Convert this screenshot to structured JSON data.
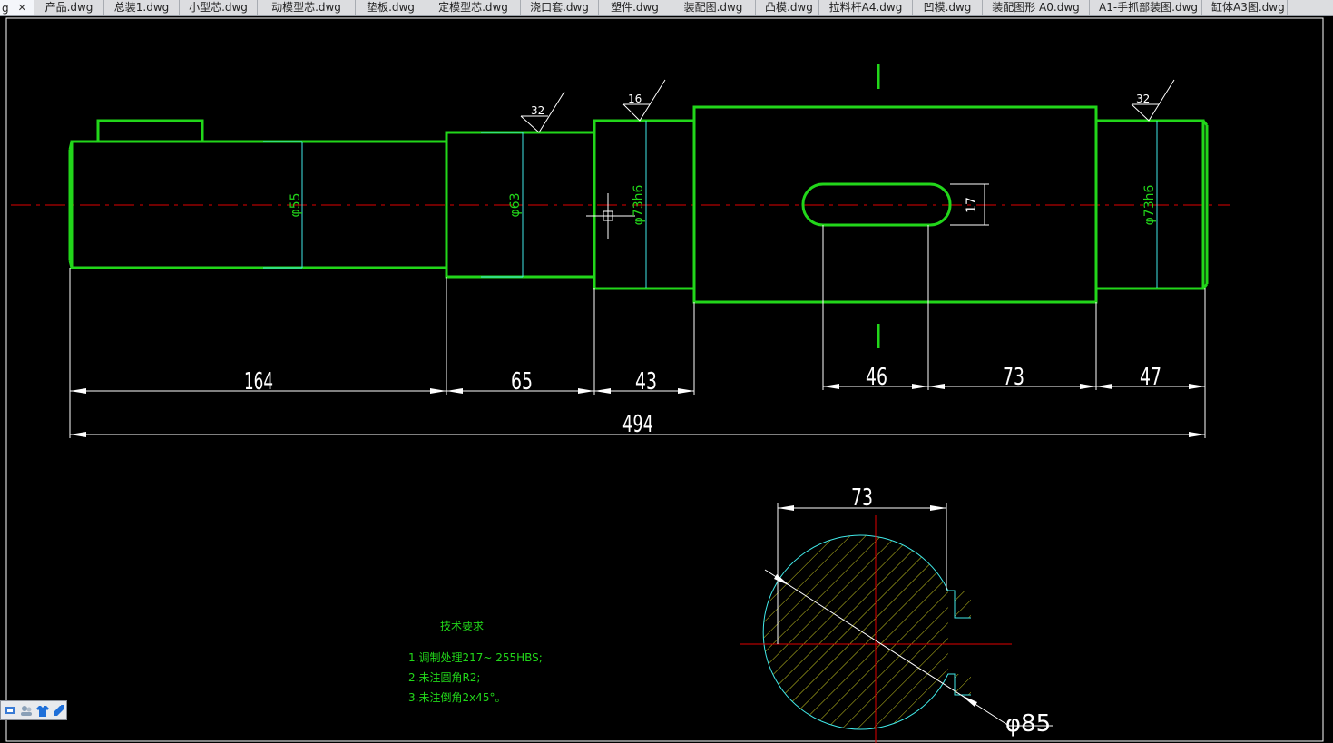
{
  "tabs": [
    {
      "label": "g",
      "active": true
    },
    {
      "label": "产品.dwg"
    },
    {
      "label": "总装1.dwg"
    },
    {
      "label": "小型芯.dwg"
    },
    {
      "label": "动模型芯.dwg"
    },
    {
      "label": "垫板.dwg"
    },
    {
      "label": "定模型芯.dwg"
    },
    {
      "label": "浇口套.dwg"
    },
    {
      "label": "塑件.dwg"
    },
    {
      "label": "装配图.dwg"
    },
    {
      "label": "凸模.dwg"
    },
    {
      "label": "拉料杆A4.dwg"
    },
    {
      "label": "凹模.dwg"
    },
    {
      "label": "装配图形 A0.dwg"
    },
    {
      "label": "A1-手抓部装图.dwg"
    },
    {
      "label": "缸体A3图.dwg"
    }
  ],
  "tab_close_glyph": "✕",
  "colors": {
    "outline": "#22d61a",
    "dimension": "#ffffff",
    "centerline": "#e00000",
    "hatch": "#c8c820",
    "section_outline": "#40e8e8",
    "text": "#22d61a"
  },
  "drawing": {
    "diameters": {
      "d55": "φ55",
      "d63": "φ63",
      "d73a": "φ73h6",
      "d73b": "φ73h6"
    },
    "keyway_depth": "17",
    "roughness": {
      "r1": "32",
      "r2": "16",
      "r3": "32"
    },
    "dims": {
      "l164": "164",
      "l65": "65",
      "l43": "43",
      "l46": "46",
      "l73": "73",
      "l47": "47",
      "total": "494"
    },
    "section": {
      "width": "73",
      "diameter": "φ85"
    },
    "tech_req": {
      "title": "技术要求",
      "items": [
        "1.调制处理217~ 255HBS;",
        "2.未注圆角R2;",
        "3.未注倒角2x45°。"
      ]
    }
  },
  "toolbar_icons": [
    "layers-icon",
    "users-icon",
    "shirt-icon",
    "wrench-icon"
  ]
}
